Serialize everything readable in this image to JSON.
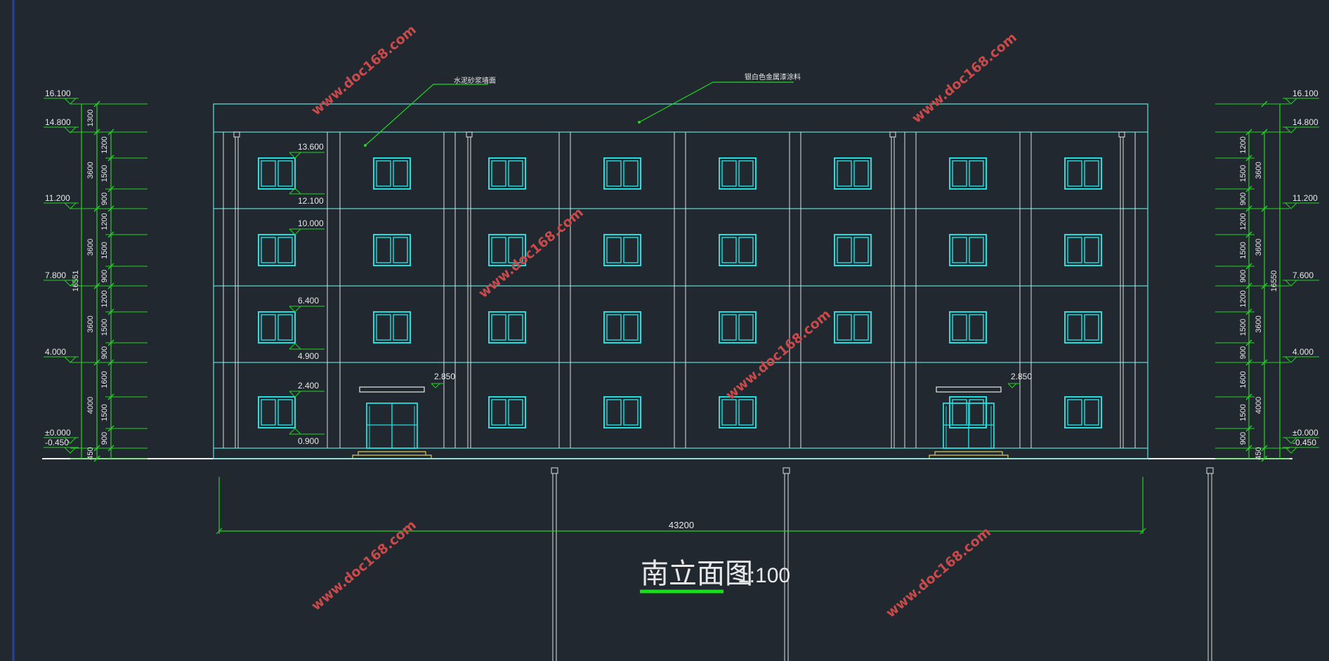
{
  "drawing": {
    "title": "南立面图",
    "scale": "1:100",
    "overall_dimension": "43200"
  },
  "annotations": {
    "cornice_material": "水泥砂浆墙面",
    "wall_material": "银白色金属漆涂料"
  },
  "left_levels": [
    "16.100",
    "14.800",
    "11.200",
    "7.800",
    "4.000",
    "±0.000",
    "-0.450"
  ],
  "right_levels": [
    "16.100",
    "14.800",
    "11.200",
    "7.600",
    "4.000",
    "±0.000",
    "-0.450"
  ],
  "left_overall_height": "16551",
  "right_overall_height": "16550",
  "floor_dims_left": [
    "1300",
    "3600",
    "3600",
    "3600",
    "4000",
    "450"
  ],
  "floor_dims_right": [
    "3600",
    "3600",
    "3600",
    "4000",
    "450"
  ],
  "detail_dims_left": [
    "1200",
    "1500",
    "900",
    "1200",
    "1500",
    "900",
    "1200",
    "1500",
    "900",
    "1600",
    "1500",
    "900"
  ],
  "detail_dims_right": [
    "1200",
    "1500",
    "900",
    "1200",
    "1500",
    "900",
    "1200",
    "1500",
    "900",
    "1600",
    "1500",
    "900"
  ],
  "window_elevations": [
    "13.600",
    "12.100",
    "10.000",
    "6.400",
    "4.900",
    "2.400",
    "0.900"
  ],
  "door_elevations": [
    "2.850",
    "2.850"
  ],
  "watermark": "www.doc168.com",
  "colors": {
    "background": "#212830",
    "outline": "#5fd3cf",
    "window": "#22dede",
    "dimension": "#22d422",
    "text": "#e8e8e8",
    "watermark": "#c84a4a",
    "steps": "#d8c860"
  }
}
